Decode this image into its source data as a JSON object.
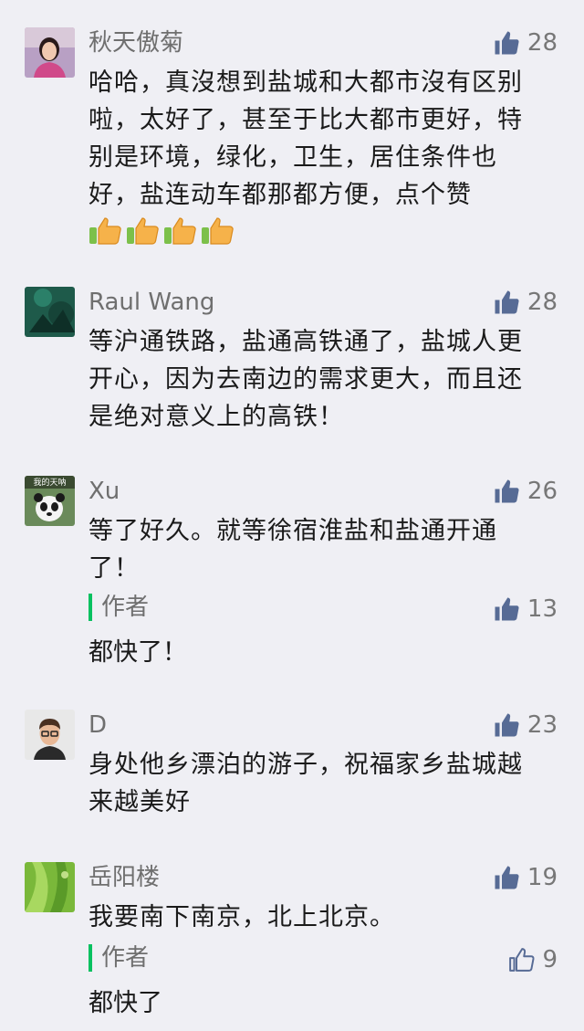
{
  "colors": {
    "background": "#efeff4",
    "author_bar": "#07c160",
    "muted": "#6f6f6f",
    "like_filled": "#576b95"
  },
  "comments": [
    {
      "name": "秋天傲菊",
      "likes": "28",
      "like_icon": "thumbs-up-filled-icon",
      "text": "哈哈，真沒想到盐城和大都市沒有区别啦，太好了，甚至于比大都市更好，特别是环境，绿化，卫生，居住条件也好，盐连动车都那都方便，点个赞",
      "emojis": [
        "thumbs-up-emoji",
        "thumbs-up-emoji",
        "thumbs-up-emoji",
        "thumbs-up-emoji"
      ]
    },
    {
      "name": "Raul Wang",
      "likes": "28",
      "like_icon": "thumbs-up-filled-icon",
      "text": "等沪通铁路，盐通高铁通了，盐城人更开心，因为去南边的需求更大，而且还是绝对意义上的高铁！"
    },
    {
      "name": "Xu",
      "avatar_text": "我的天呐",
      "likes": "26",
      "like_icon": "thumbs-up-filled-icon",
      "text": "等了好久。就等徐宿淮盐和盐通开通了！",
      "reply": {
        "label": "作者",
        "likes": "13",
        "like_icon": "thumbs-up-filled-icon",
        "text": "都快了！"
      }
    },
    {
      "name": "D",
      "likes": "23",
      "like_icon": "thumbs-up-filled-icon",
      "text": "身处他乡漂泊的游子，祝福家乡盐城越来越美好"
    },
    {
      "name": "岳阳楼",
      "likes": "19",
      "like_icon": "thumbs-up-filled-icon",
      "text": "我要南下南京，北上北京。",
      "reply": {
        "label": "作者",
        "likes": "9",
        "like_icon": "thumbs-up-outline-icon",
        "text": "都快了"
      }
    }
  ]
}
